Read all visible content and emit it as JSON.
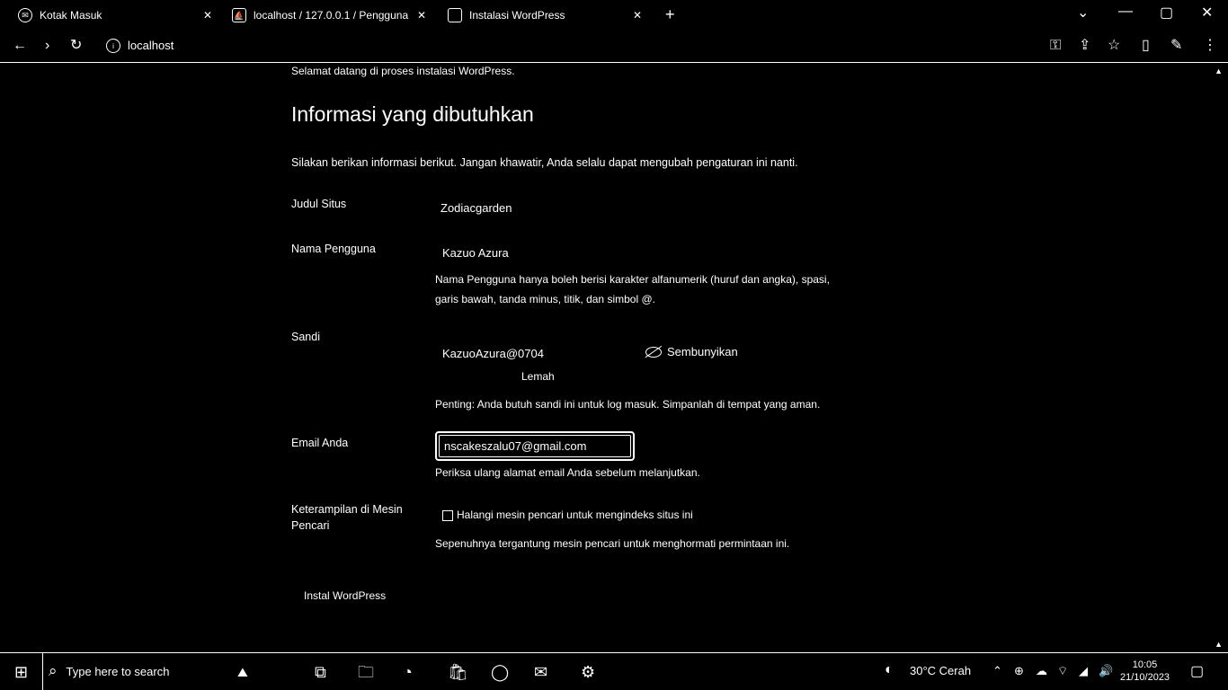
{
  "tabs": [
    {
      "title": "Kotak Masuk",
      "icon": "mail-icon"
    },
    {
      "title": "localhost / 127.0.0.1 / Pengguna",
      "icon": "phpmyadmin-icon"
    },
    {
      "title": "Instalasi WordPress",
      "icon": "page-icon"
    }
  ],
  "new_tab": "+",
  "url": "localhost",
  "page": {
    "top_cut_text": "Selamat datang di proses instalasi WordPress.",
    "heading": "Informasi yang dibutuhkan",
    "intro": "Silakan berikan informasi berikut. Jangan khawatir, Anda selalu dapat mengubah pengaturan ini nanti.",
    "fields": {
      "site_title": {
        "label": "Judul Situs",
        "value": "Zodiacgarden"
      },
      "username": {
        "label": "Nama Pengguna",
        "value": "Kazuo Azura",
        "note_line1": "Nama Pengguna hanya boleh berisi karakter alfanumerik (huruf dan angka), spasi,",
        "note_line2": "garis bawah, tanda minus, titik, dan simbol @."
      },
      "password": {
        "label": "Sandi",
        "value": "KazuoAzura@0704",
        "hide_label": "Sembunyikan",
        "strength": "Lemah",
        "note": "Penting: Anda butuh sandi ini untuk log masuk. Simpanlah di tempat yang aman."
      },
      "email": {
        "label": "Email Anda",
        "value": "nscakeszalu07@gmail.com",
        "note": "Periksa ulang alamat email Anda sebelum melanjutkan."
      },
      "search_visibility": {
        "label_line1": "Keterampilan di Mesin",
        "label_line2": "Pencari",
        "checkbox_label": "Halangi mesin pencari untuk mengindeks situs ini",
        "note": "Sepenuhnya tergantung mesin pencari untuk menghormati permintaan ini."
      }
    },
    "install_button": "Instal WordPress"
  },
  "taskbar": {
    "search_placeholder": "Type here to search",
    "weather": "30°C Cerah",
    "time": "10:05",
    "date": "21/10/2023"
  }
}
